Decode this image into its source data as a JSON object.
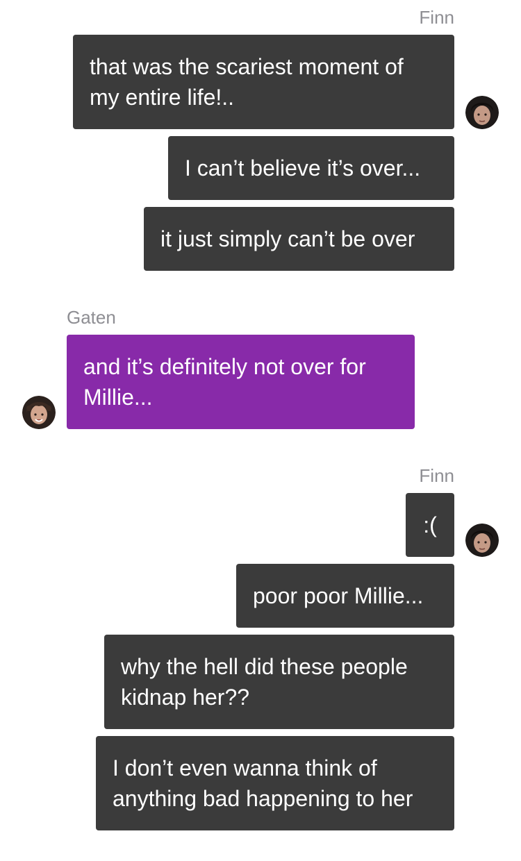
{
  "groups": [
    {
      "sender": "Finn",
      "side": "right",
      "messages": [
        "that was the scariest moment of my entire life!..",
        "I can’t believe it’s over...",
        "it just simply can’t be over"
      ]
    },
    {
      "sender": "Gaten",
      "side": "left",
      "messages": [
        "and it’s definitely not over for Millie..."
      ]
    },
    {
      "sender": "Finn",
      "side": "right",
      "messages": [
        ":(",
        "poor poor Millie...",
        "why the hell did these people kidnap her??",
        "I don’t even wanna think of anything bad happening to her"
      ]
    }
  ],
  "colors": {
    "finn_bubble": "#3b3b3b",
    "gaten_bubble": "#882aa9",
    "name_text": "#8e8e93"
  },
  "icons": {
    "finn_avatar": "finn-avatar-icon",
    "gaten_avatar": "gaten-avatar-icon"
  }
}
